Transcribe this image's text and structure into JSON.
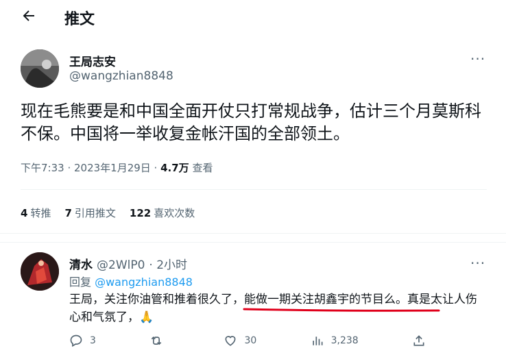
{
  "header": {
    "title": "推文"
  },
  "tweet": {
    "author_name": "王局志安",
    "author_handle": "@wangzhian8848",
    "text": "现在毛熊要是和中国全面开仗只打常规战争，估计三个月莫斯科不保。中国将一举收复金帐汗国的全部领土。",
    "time": "下午7:33 · 2023年1月29日 · ",
    "views_count": "4.7万",
    "views_label": " 查看",
    "retweets_count": "4",
    "retweets_label": "转推",
    "quotes_count": "7",
    "quotes_label": "引用推文",
    "likes_count": "122",
    "likes_label": "喜欢次数"
  },
  "reply": {
    "author_name": "清水",
    "author_handle": "@2WlP0",
    "time": "· 2小时",
    "reply_to_prefix": "回复 ",
    "reply_to_handle": "@wangzhian8848",
    "text": "王局，关注你油管和推着很久了，能做一期关注胡鑫宇的节目么。真是太让人伤心和气氛了，🙏",
    "replies": "3",
    "retweets": "",
    "likes": "30",
    "views": "3,238"
  },
  "colors": {
    "accent": "#1d9bf0",
    "muted": "#536471",
    "annotation": "#e0001b"
  },
  "icons": [
    "back-arrow-icon",
    "more-icon",
    "reply-icon",
    "retweet-icon",
    "like-icon",
    "views-icon",
    "share-icon"
  ]
}
